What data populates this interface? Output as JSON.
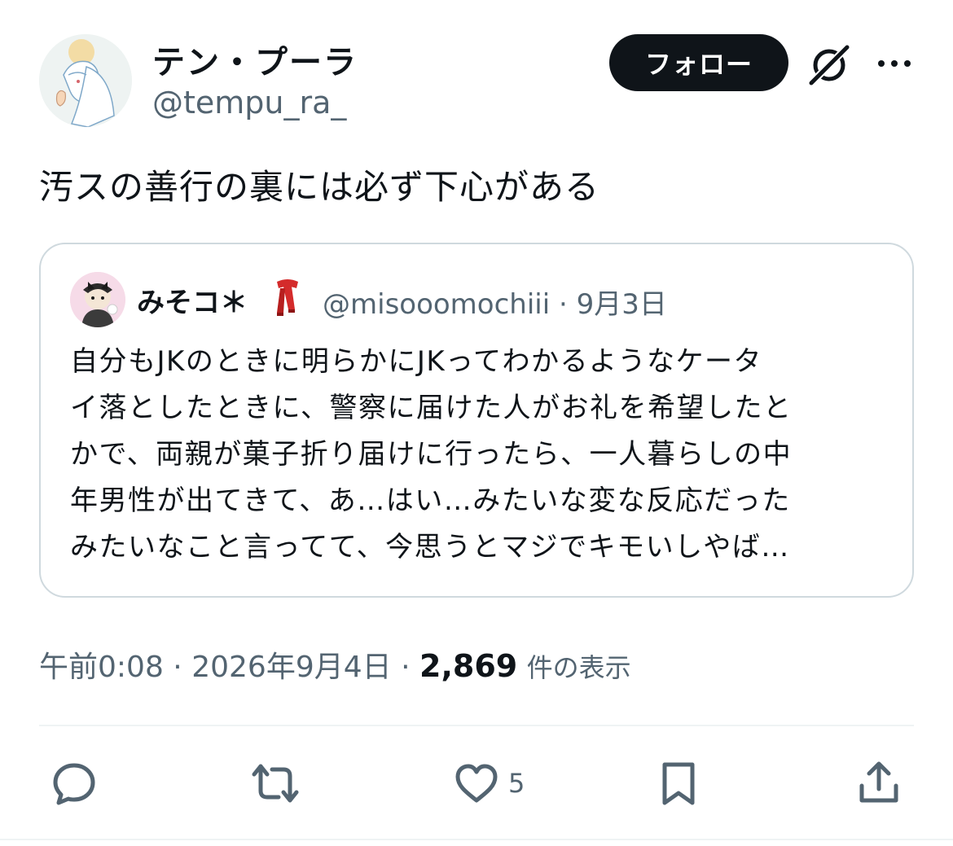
{
  "tweet": {
    "author": {
      "display_name": "テン・プーラ",
      "handle": "@tempu_ra_"
    },
    "follow_label": "フォロー",
    "text": "汚スの善行の裏には必ず下心がある",
    "quoted": {
      "display_name": "みそコ＊",
      "emoji": "🧣",
      "handle": "@misooomochiii",
      "separator": "·",
      "date": "9月3日",
      "lines": [
        "自分もJKのときに明らかにJKってわかるようなケータ",
        "イ落としたときに、警察に届けた人がお礼を希望したと",
        "かで、両親が菓子折り届けに行ったら、一人暮らしの中",
        "年男性が出てきて、あ…はい…みたいな変な反応だった",
        "みたいなこと言ってて、今思うとマジでキモいしやば…"
      ]
    },
    "time": "午前0:08",
    "date": "2026年9月4日",
    "separator": "·",
    "views_count": "2,869",
    "views_label": "件の表示",
    "like_count": "5"
  },
  "icons": {
    "header": [
      "grok-icon",
      "more-icon"
    ],
    "actions": [
      "reply-icon",
      "retweet-icon",
      "like-icon",
      "bookmark-icon",
      "share-icon"
    ]
  },
  "colors": {
    "text": "#0f1419",
    "secondary": "#536471",
    "border": "#cfd9de",
    "button": "#0f1419"
  }
}
